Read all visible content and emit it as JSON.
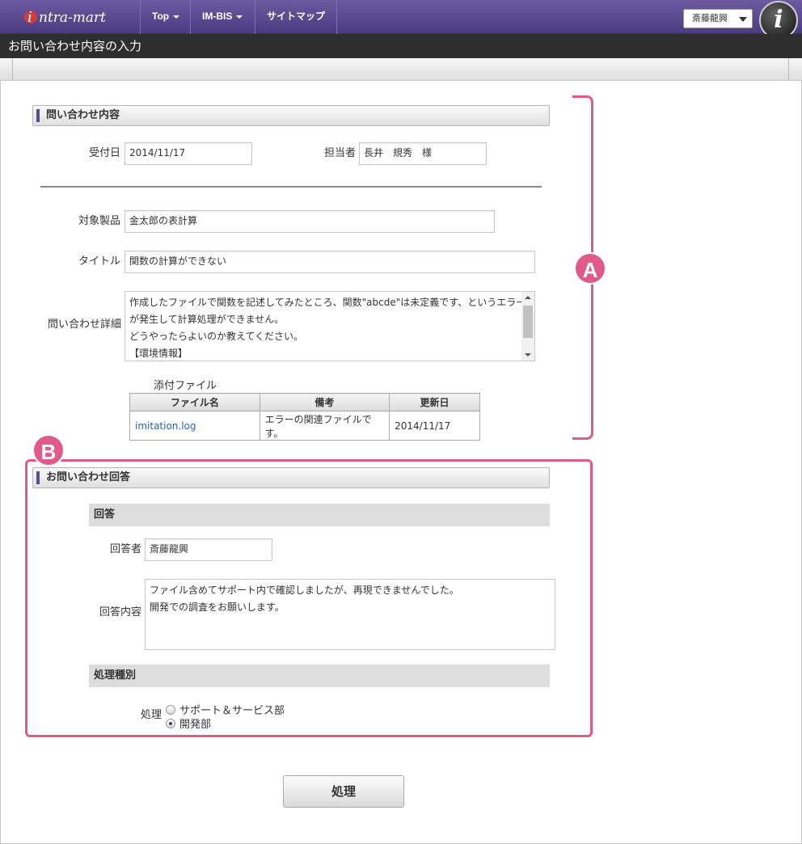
{
  "header": {
    "logo_text": "intra-mart",
    "nav": [
      {
        "label": "Top"
      },
      {
        "label": "IM-BIS"
      },
      {
        "label": "サイトマップ"
      }
    ],
    "user": "斎藤龍興",
    "page_title": "お問い合わせ内容の入力"
  },
  "inquiry": {
    "section_title": "問い合わせ内容",
    "received_date_label": "受付日",
    "received_date": "2014/11/17",
    "assignee_label": "担当者",
    "assignee": "長井　規秀　様",
    "product_label": "対象製品",
    "product": "金太郎の表計算",
    "title_label": "タイトル",
    "title": "関数の計算ができない",
    "detail_label": "問い合わせ詳細",
    "detail_lines": [
      "作成したファイルで関数を記述してみたところ、関数\"abcde\"は未定義です、というエラー",
      "が発生して計算処理ができません。",
      "どうやったらよいのか教えてください。",
      "【環境情報】"
    ],
    "attachments_label": "添付ファイル",
    "attachments_columns": [
      "ファイル名",
      "備考",
      "更新日"
    ],
    "attachments": [
      {
        "name": "imitation.log",
        "note": "エラーの関連ファイルです。",
        "date": "2014/11/17"
      }
    ]
  },
  "answer": {
    "section_title": "お問い合わせ回答",
    "sub_title": "回答",
    "responder_label": "回答者",
    "responder": "斎藤龍興",
    "content_label": "回答内容",
    "content_lines": [
      "ファイル含めてサポート内で確認しましたが、再現できませんでした。",
      "開発での調査をお願いします。"
    ],
    "process_title": "処理種別",
    "process_label": "処理",
    "options": [
      {
        "label": "サポート＆サービス部",
        "checked": false
      },
      {
        "label": "開発部",
        "checked": true
      }
    ]
  },
  "annotations": {
    "a": "A",
    "b": "B"
  },
  "submit_label": "処理",
  "colors": {
    "accent": "#5a4a98",
    "marker": "#e05a8c",
    "link": "#2d5fb0"
  }
}
